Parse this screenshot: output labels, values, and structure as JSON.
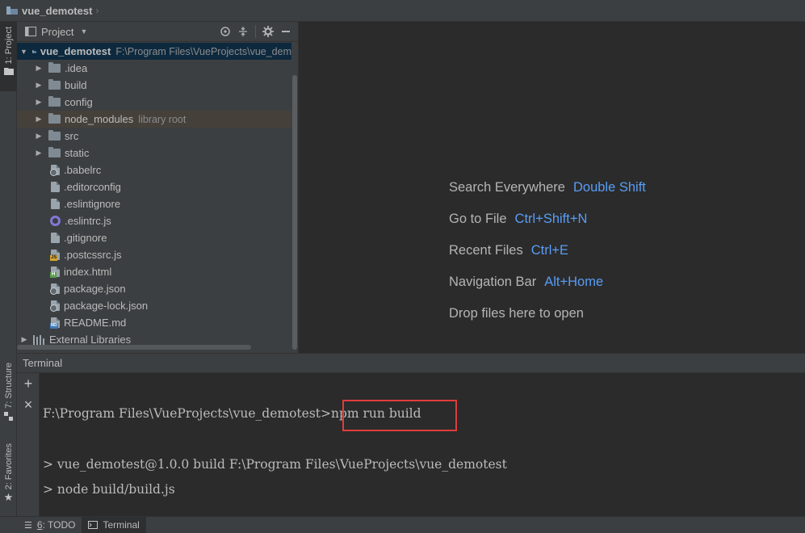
{
  "navbar": {
    "breadcrumb": "vue_demotest",
    "chevron": "›"
  },
  "left_strip": {
    "project_tab": "1: Project",
    "structure_tab": "7: Structure",
    "favorites_tab": "2: Favorites"
  },
  "project_panel": {
    "title": "Project",
    "dropdown_glyph": "▼",
    "tools": [
      "target-icon",
      "collapse-icon",
      "gear-icon",
      "minimize-icon"
    ]
  },
  "tree": {
    "root": {
      "name": "vue_demotest",
      "path": "F:\\Program Files\\VueProjects\\vue_dem"
    },
    "folders": [
      ".idea",
      "build",
      "config",
      "node_modules",
      "src",
      "static"
    ],
    "node_modules_hint": "library root",
    "files": [
      ".babelrc",
      ".editorconfig",
      ".eslintignore",
      ".eslintrc.js",
      ".gitignore",
      ".postcssrc.js",
      "index.html",
      "package.json",
      "package-lock.json",
      "README.md"
    ],
    "external": "External Libraries"
  },
  "editor": {
    "hints": [
      {
        "label": "Search Everywhere",
        "shortcut": "Double Shift"
      },
      {
        "label": "Go to File",
        "shortcut": "Ctrl+Shift+N"
      },
      {
        "label": "Recent Files",
        "shortcut": "Ctrl+E"
      },
      {
        "label": "Navigation Bar",
        "shortcut": "Alt+Home"
      },
      {
        "label": "Drop files here to open",
        "shortcut": ""
      }
    ]
  },
  "terminal": {
    "title": "Terminal",
    "add_glyph": "+",
    "close_glyph": "×",
    "prompt": "F:\\Program Files\\VueProjects\\vue_demotest>",
    "command": "npm run build",
    "output1": "> vue_demotest@1.0.0 build F:\\Program Files\\VueProjects\\vue_demotest",
    "output2": "> node build/build.js"
  },
  "bottom_bar": {
    "todo_num": "6",
    "todo_label": ": TODO",
    "terminal_label": "Terminal"
  },
  "colors": {
    "accent_shortcut": "#589df6",
    "highlight_box": "#e03c3c",
    "root_row": "#0d293e"
  }
}
